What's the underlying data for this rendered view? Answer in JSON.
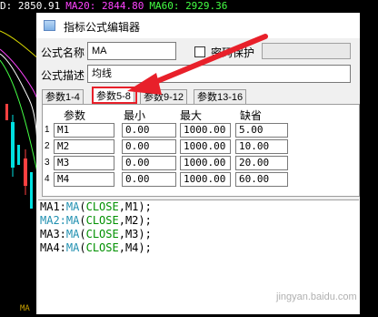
{
  "chart": {
    "ma_values": [
      {
        "label": "D: 2850.91",
        "color": "#ffffff"
      },
      {
        "label": "MA20: 2844.80",
        "color": "#ff44ff"
      },
      {
        "label": "MA60: 2929.36",
        "color": "#44ff44"
      }
    ],
    "axis_label": "MA"
  },
  "dialog": {
    "title": "指标公式编辑器",
    "formula_name_label": "公式名称",
    "formula_name_value": "MA",
    "password_label": "密码保护",
    "formula_desc_label": "公式描述",
    "formula_desc_value": "均线",
    "right_label_1": "公式",
    "right_label_2": "公式",
    "tabs": [
      {
        "label": "参数1-4",
        "active": false
      },
      {
        "label": "参数5-8",
        "active": true
      },
      {
        "label": "参数9-12",
        "active": false
      },
      {
        "label": "参数13-16",
        "active": false
      }
    ],
    "params_header": {
      "param": "参数",
      "min": "最小",
      "max": "最大",
      "default": "缺省"
    },
    "params": [
      {
        "idx": "1",
        "name": "M1",
        "min": "0.00",
        "max": "1000.00",
        "default": "5.00"
      },
      {
        "idx": "2",
        "name": "M2",
        "min": "0.00",
        "max": "1000.00",
        "default": "10.00"
      },
      {
        "idx": "3",
        "name": "M3",
        "min": "0.00",
        "max": "1000.00",
        "default": "20.00"
      },
      {
        "idx": "4",
        "name": "M4",
        "min": "0.00",
        "max": "1000.00",
        "default": "60.00"
      }
    ]
  },
  "editor": {
    "lines": [
      {
        "prefix": "MA1:",
        "fn": "MA",
        "open": "(",
        "arg1": "CLOSE",
        "sep": ",",
        "arg2": "M1",
        "close": ");"
      },
      {
        "prefix": "MA2:",
        "fn": "MA",
        "open": "(",
        "arg1": "CLOSE",
        "sep": ",",
        "arg2": "M2",
        "close": ");"
      },
      {
        "prefix": "MA3:",
        "fn": "MA",
        "open": "(",
        "arg1": "CLOSE",
        "sep": ",",
        "arg2": "M3",
        "close": ");"
      },
      {
        "prefix": "MA4:",
        "fn": "MA",
        "open": "(",
        "arg1": "CLOSE",
        "sep": ",",
        "arg2": "M4",
        "close": ");"
      }
    ]
  },
  "watermark": "jingyan.baidu.com",
  "colors": {
    "annotation": "#e8202a",
    "chart_bg": "#000000",
    "dialog_bg": "#f0f0f0"
  }
}
